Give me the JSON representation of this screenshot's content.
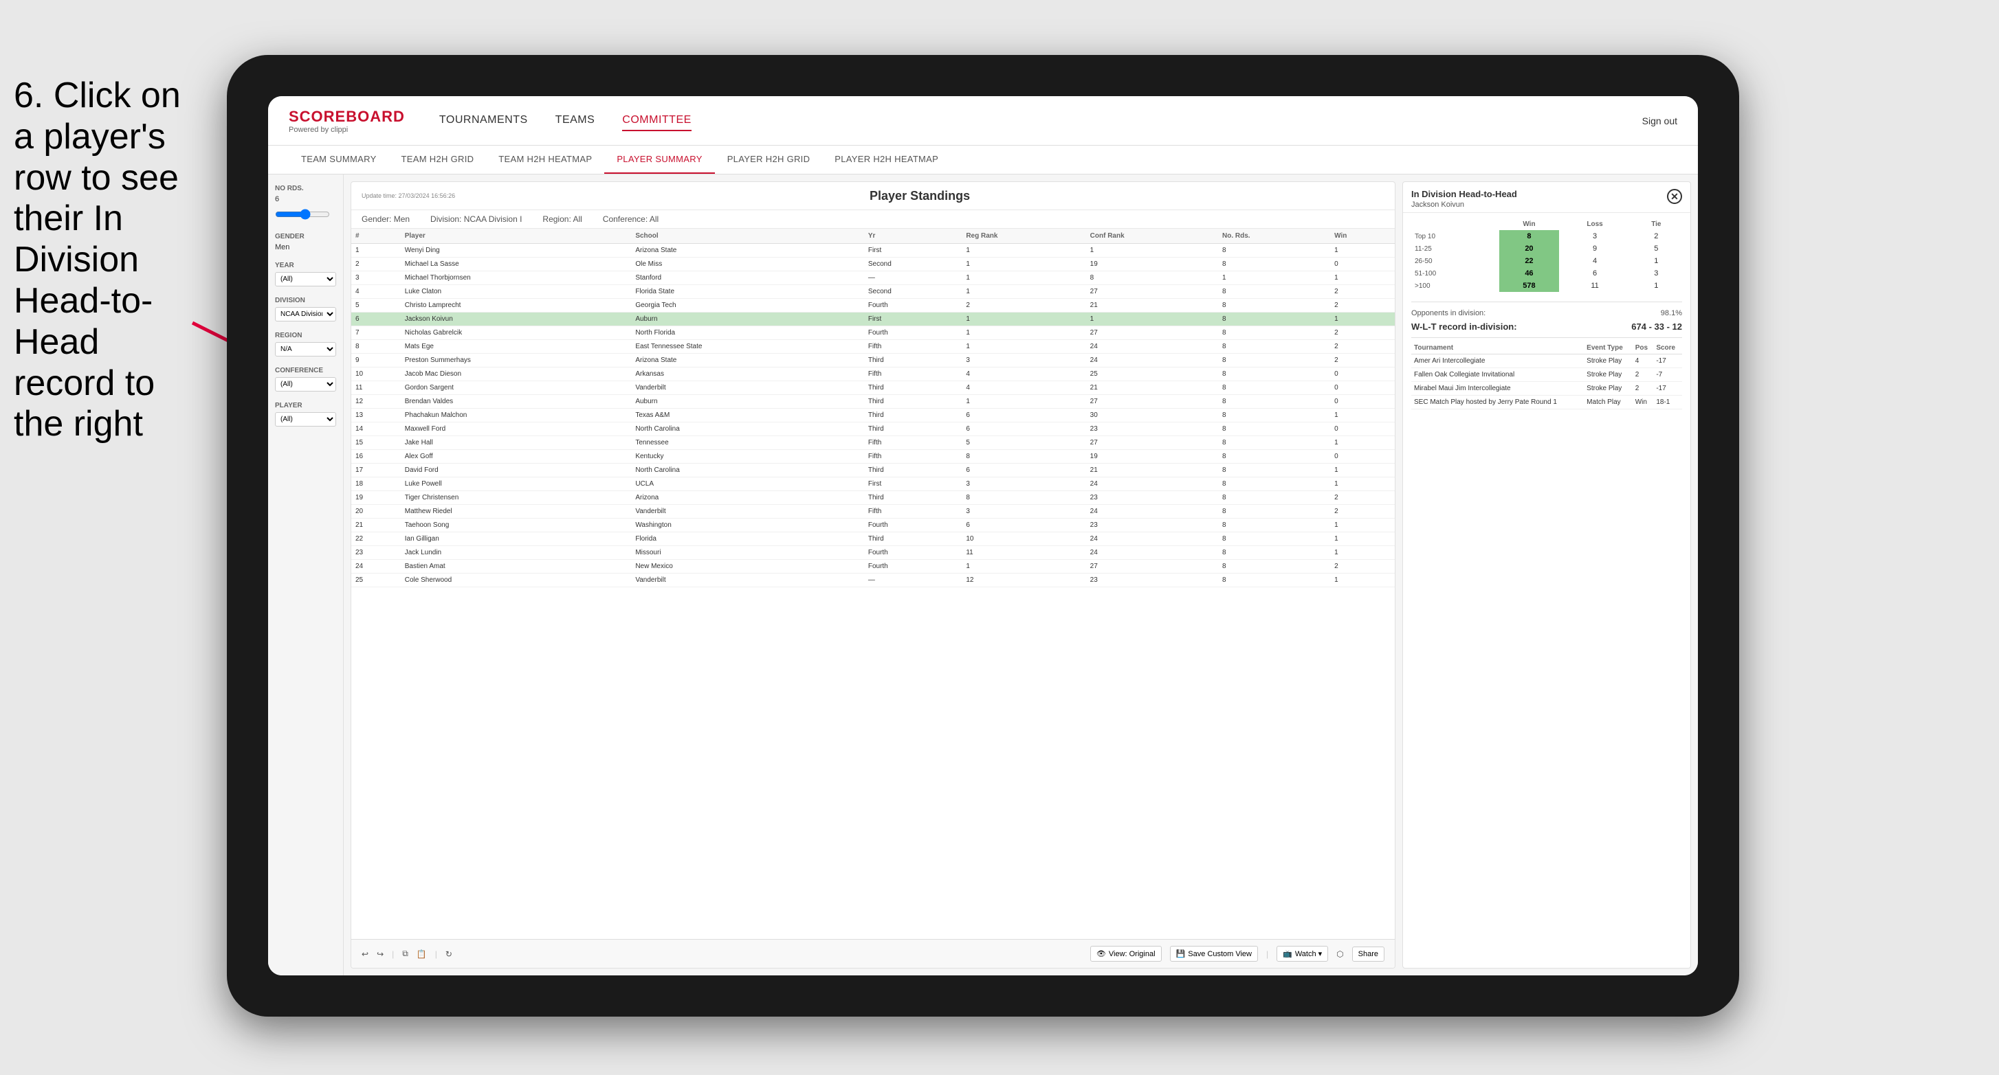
{
  "instruction": {
    "text": "6. Click on a player's row to see their In Division Head-to-Head record to the right"
  },
  "nav": {
    "logo": "SCOREBOARD",
    "logo_sub": "Powered by clippi",
    "items": [
      "TOURNAMENTS",
      "TEAMS",
      "COMMITTEE"
    ],
    "sign_out": "Sign out"
  },
  "sub_nav": {
    "items": [
      "TEAM SUMMARY",
      "TEAM H2H GRID",
      "TEAM H2H HEATMAP",
      "PLAYER SUMMARY",
      "PLAYER H2H GRID",
      "PLAYER H2H HEATMAP"
    ]
  },
  "panel": {
    "title": "Player Standings",
    "update": "Update time:",
    "update_date": "27/03/2024 16:56:26",
    "filters": {
      "gender": "Gender: Men",
      "division": "Division: NCAA Division I",
      "region": "Region: All",
      "conference": "Conference: All"
    }
  },
  "sidebar": {
    "no_rds_label": "No Rds.",
    "no_rds_value": "6",
    "gender_label": "Gender",
    "gender_value": "Men",
    "year_label": "Year",
    "year_value": "(All)",
    "division_label": "Division",
    "division_value": "NCAA Division I",
    "region_label": "Region",
    "region_value": "N/A",
    "conference_label": "Conference",
    "conference_value": "(All)",
    "player_label": "Player",
    "player_value": "(All)"
  },
  "table": {
    "headers": [
      "#",
      "Player",
      "School",
      "Yr",
      "Reg Rank",
      "Conf Rank",
      "No. Rds.",
      "Win"
    ],
    "rows": [
      {
        "rank": "1",
        "num": "1",
        "player": "Wenyi Ding",
        "school": "Arizona State",
        "year": "First",
        "reg": "1",
        "conf": "1",
        "rds": "8",
        "win": "1"
      },
      {
        "rank": "2",
        "num": "2",
        "player": "Michael La Sasse",
        "school": "Ole Miss",
        "year": "Second",
        "reg": "1",
        "conf": "19",
        "rds": "8",
        "win": "0"
      },
      {
        "rank": "3",
        "num": "3",
        "player": "Michael Thorbjornsen",
        "school": "Stanford",
        "year": "—",
        "reg": "1",
        "conf": "8",
        "rds": "1",
        "win": "1"
      },
      {
        "rank": "4",
        "num": "4",
        "player": "Luke Claton",
        "school": "Florida State",
        "year": "Second",
        "reg": "1",
        "conf": "27",
        "rds": "8",
        "win": "2"
      },
      {
        "rank": "5",
        "num": "5",
        "player": "Christo Lamprecht",
        "school": "Georgia Tech",
        "year": "Fourth",
        "reg": "2",
        "conf": "21",
        "rds": "8",
        "win": "2"
      },
      {
        "rank": "6",
        "num": "6",
        "player": "Jackson Koivun",
        "school": "Auburn",
        "year": "First",
        "reg": "1",
        "conf": "1",
        "rds": "8",
        "win": "1",
        "selected": true
      },
      {
        "rank": "7",
        "num": "7",
        "player": "Nicholas Gabrelcik",
        "school": "North Florida",
        "year": "Fourth",
        "reg": "1",
        "conf": "27",
        "rds": "8",
        "win": "2"
      },
      {
        "rank": "8",
        "num": "8",
        "player": "Mats Ege",
        "school": "East Tennessee State",
        "year": "Fifth",
        "reg": "1",
        "conf": "24",
        "rds": "8",
        "win": "2"
      },
      {
        "rank": "9",
        "num": "9",
        "player": "Preston Summerhays",
        "school": "Arizona State",
        "year": "Third",
        "reg": "3",
        "conf": "24",
        "rds": "8",
        "win": "2"
      },
      {
        "rank": "10",
        "num": "10",
        "player": "Jacob Mac Dieson",
        "school": "Arkansas",
        "year": "Fifth",
        "reg": "4",
        "conf": "25",
        "rds": "8",
        "win": "0"
      },
      {
        "rank": "11",
        "num": "11",
        "player": "Gordon Sargent",
        "school": "Vanderbilt",
        "year": "Third",
        "reg": "4",
        "conf": "21",
        "rds": "8",
        "win": "0"
      },
      {
        "rank": "12",
        "num": "12",
        "player": "Brendan Valdes",
        "school": "Auburn",
        "year": "Third",
        "reg": "1",
        "conf": "27",
        "rds": "8",
        "win": "0"
      },
      {
        "rank": "13",
        "num": "13",
        "player": "Phachakun Malchon",
        "school": "Texas A&M",
        "year": "Third",
        "reg": "6",
        "conf": "30",
        "rds": "8",
        "win": "1"
      },
      {
        "rank": "14",
        "num": "14",
        "player": "Maxwell Ford",
        "school": "North Carolina",
        "year": "Third",
        "reg": "6",
        "conf": "23",
        "rds": "8",
        "win": "0"
      },
      {
        "rank": "15",
        "num": "15",
        "player": "Jake Hall",
        "school": "Tennessee",
        "year": "Fifth",
        "reg": "5",
        "conf": "27",
        "rds": "8",
        "win": "1"
      },
      {
        "rank": "16",
        "num": "16",
        "player": "Alex Goff",
        "school": "Kentucky",
        "year": "Fifth",
        "reg": "8",
        "conf": "19",
        "rds": "8",
        "win": "0"
      },
      {
        "rank": "17",
        "num": "17",
        "player": "David Ford",
        "school": "North Carolina",
        "year": "Third",
        "reg": "6",
        "conf": "21",
        "rds": "8",
        "win": "1"
      },
      {
        "rank": "18",
        "num": "18",
        "player": "Luke Powell",
        "school": "UCLA",
        "year": "First",
        "reg": "3",
        "conf": "24",
        "rds": "8",
        "win": "1"
      },
      {
        "rank": "19",
        "num": "19",
        "player": "Tiger Christensen",
        "school": "Arizona",
        "year": "Third",
        "reg": "8",
        "conf": "23",
        "rds": "8",
        "win": "2"
      },
      {
        "rank": "20",
        "num": "20",
        "player": "Matthew Riedel",
        "school": "Vanderbilt",
        "year": "Fifth",
        "reg": "3",
        "conf": "24",
        "rds": "8",
        "win": "2"
      },
      {
        "rank": "21",
        "num": "21",
        "player": "Taehoon Song",
        "school": "Washington",
        "year": "Fourth",
        "reg": "6",
        "conf": "23",
        "rds": "8",
        "win": "1"
      },
      {
        "rank": "22",
        "num": "22",
        "player": "Ian Gilligan",
        "school": "Florida",
        "year": "Third",
        "reg": "10",
        "conf": "24",
        "rds": "8",
        "win": "1"
      },
      {
        "rank": "23",
        "num": "23",
        "player": "Jack Lundin",
        "school": "Missouri",
        "year": "Fourth",
        "reg": "11",
        "conf": "24",
        "rds": "8",
        "win": "1"
      },
      {
        "rank": "24",
        "num": "24",
        "player": "Bastien Amat",
        "school": "New Mexico",
        "year": "Fourth",
        "reg": "1",
        "conf": "27",
        "rds": "8",
        "win": "2"
      },
      {
        "rank": "25",
        "num": "25",
        "player": "Cole Sherwood",
        "school": "Vanderbilt",
        "year": "—",
        "reg": "12",
        "conf": "23",
        "rds": "8",
        "win": "1"
      }
    ]
  },
  "h2h_panel": {
    "title": "In Division Head-to-Head",
    "player": "Jackson Koivun",
    "headers": [
      "",
      "Win",
      "Loss",
      "Tie"
    ],
    "rows": [
      {
        "range": "Top 10",
        "win": "8",
        "loss": "3",
        "tie": "2"
      },
      {
        "range": "11-25",
        "win": "20",
        "loss": "9",
        "tie": "5"
      },
      {
        "range": "26-50",
        "win": "22",
        "loss": "4",
        "tie": "1"
      },
      {
        "range": "51-100",
        "win": "46",
        "loss": "6",
        "tie": "3"
      },
      {
        "range": ">100",
        "win": "578",
        "loss": "11",
        "tie": "1"
      }
    ],
    "opponents_label": "Opponents in division:",
    "opponents_pct": "98.1%",
    "wlt_label": "W-L-T record in-division:",
    "wlt_value": "674 - 33 - 12",
    "tournament_headers": [
      "Tournament",
      "Event Type",
      "Pos",
      "Score"
    ],
    "tournaments": [
      {
        "name": "Amer Ari Intercollegiate",
        "type": "Stroke Play",
        "pos": "4",
        "score": "-17"
      },
      {
        "name": "Fallen Oak Collegiate Invitational",
        "type": "Stroke Play",
        "pos": "2",
        "score": "-7"
      },
      {
        "name": "Mirabel Maui Jim Intercollegiate",
        "type": "Stroke Play",
        "pos": "2",
        "score": "-17"
      },
      {
        "name": "SEC Match Play hosted by Jerry Pate Round 1",
        "type": "Match Play",
        "pos": "Win",
        "score": "18-1"
      }
    ]
  },
  "toolbar": {
    "view_original": "View: Original",
    "save_custom": "Save Custom View",
    "watch": "Watch ▾",
    "share": "Share"
  }
}
